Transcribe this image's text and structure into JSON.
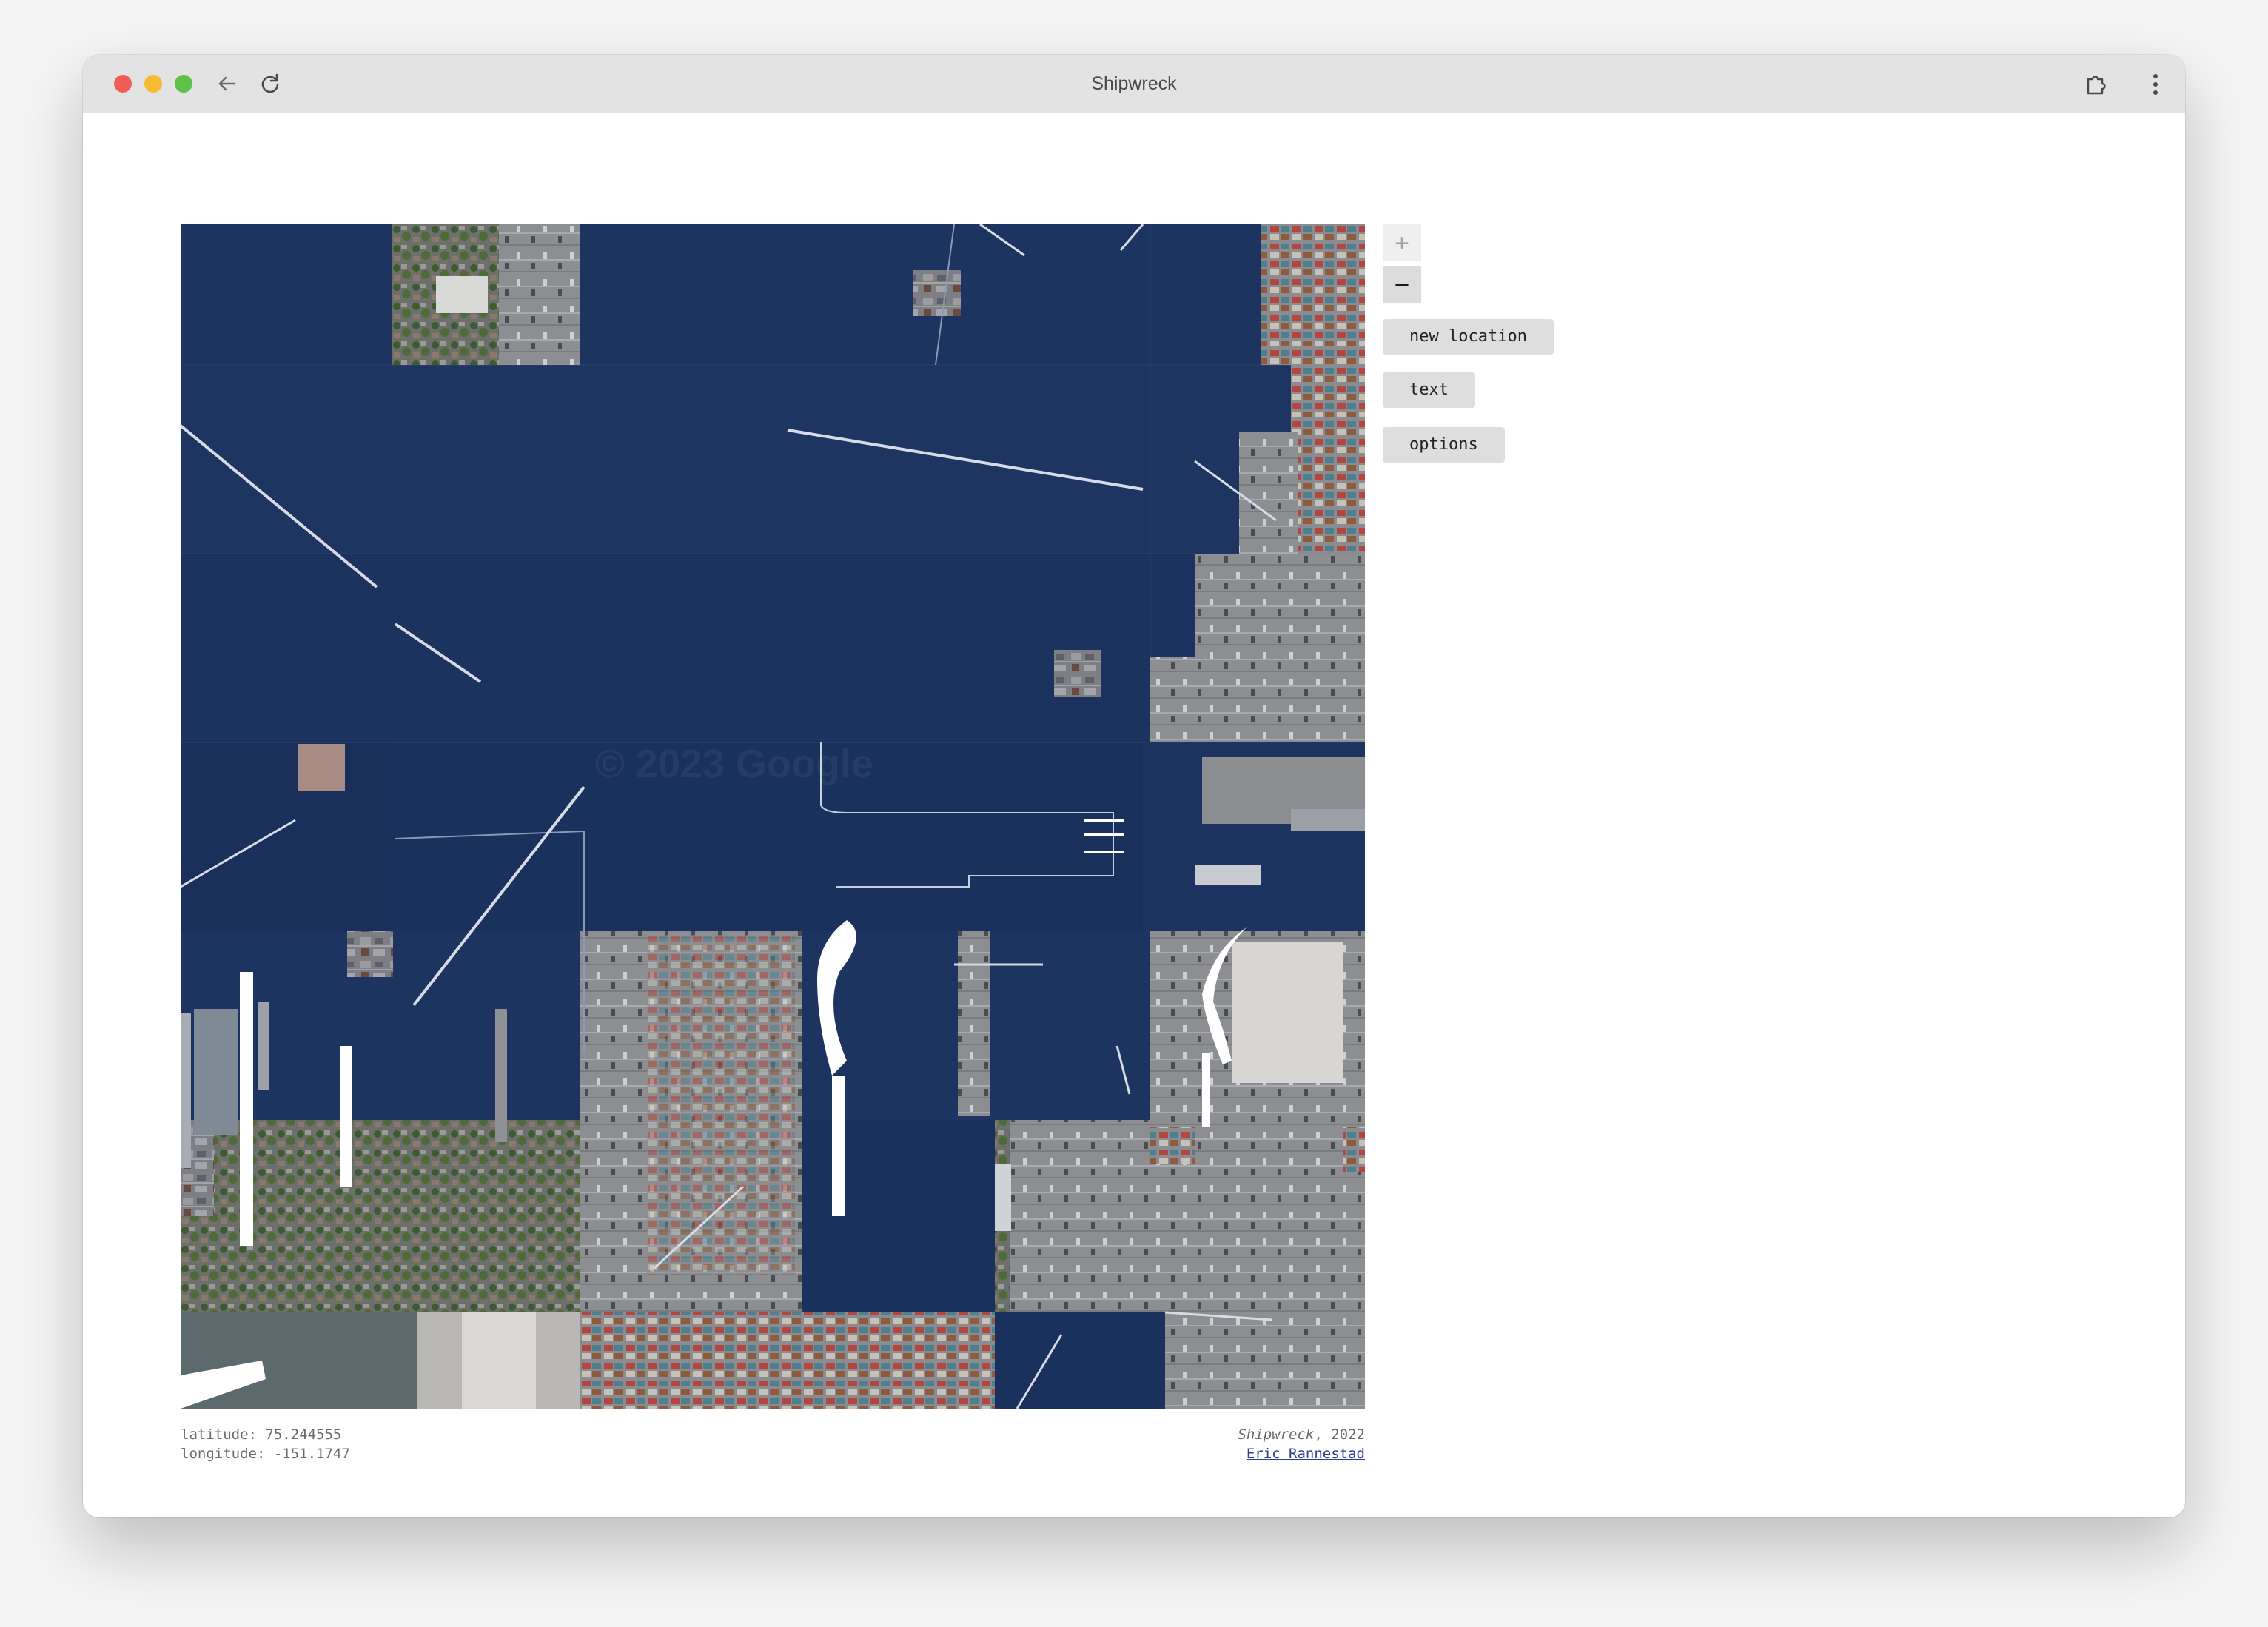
{
  "window": {
    "title": "Shipwreck"
  },
  "map": {
    "watermark": "© 2023 Google",
    "water_color": "#1d3461"
  },
  "controls": {
    "zoom_in": "+",
    "zoom_out": "−",
    "new_location": "new location",
    "text": "text",
    "options": "options"
  },
  "footer": {
    "latitude": "latitude: 75.244555",
    "longitude": "longitude: -151.1747",
    "work_title": "Shipwreck",
    "year": ", 2022",
    "author": "Eric Rannestad"
  },
  "icons": {
    "back": "arrow-left",
    "reload": "reload",
    "extension": "puzzle-piece",
    "menu": "vertical-dots"
  }
}
